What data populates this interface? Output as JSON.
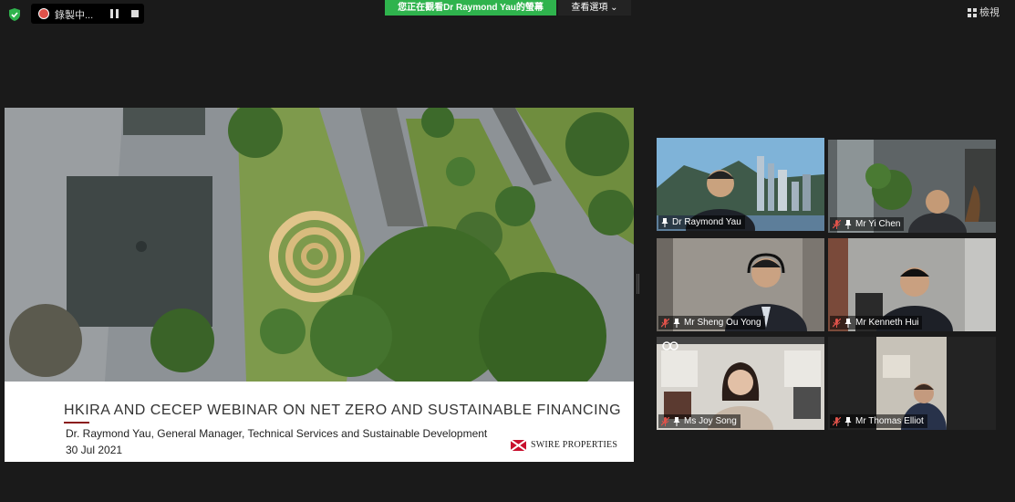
{
  "top_bar": {
    "recording_label": "錄製中...",
    "share_banner": "您正在觀看Dr Raymond Yau的螢幕",
    "view_options": "查看選項 ⌄",
    "layout_label": "檢視"
  },
  "slide": {
    "title": "HKIRA AND CECEP WEBINAR ON NET ZERO AND SUSTAINABLE FINANCING",
    "subtitle": "Dr. Raymond Yau, General Manager, Technical Services and Sustainable Development",
    "date": "30 Jul 2021",
    "logo_text": "SWIRE PROPERTIES"
  },
  "participants": [
    {
      "name": "Dr Raymond Yau",
      "muted": false,
      "active_speaker": true
    },
    {
      "name": "Mr Yi Chen",
      "muted": true,
      "active_speaker": false
    },
    {
      "name": "Mr Sheng Ou Yong",
      "muted": true,
      "active_speaker": false
    },
    {
      "name": "Mr Kenneth Hui",
      "muted": true,
      "active_speaker": false
    },
    {
      "name": "Ms Joy Song",
      "muted": true,
      "active_speaker": false
    },
    {
      "name": "Mr Thomas Elliot",
      "muted": true,
      "active_speaker": false
    }
  ],
  "colors": {
    "share_banner": "#2fb34d",
    "active_speaker_border": "#dde65b",
    "muted_icon": "#e0524a",
    "brand_red": "#8b1a1a"
  }
}
